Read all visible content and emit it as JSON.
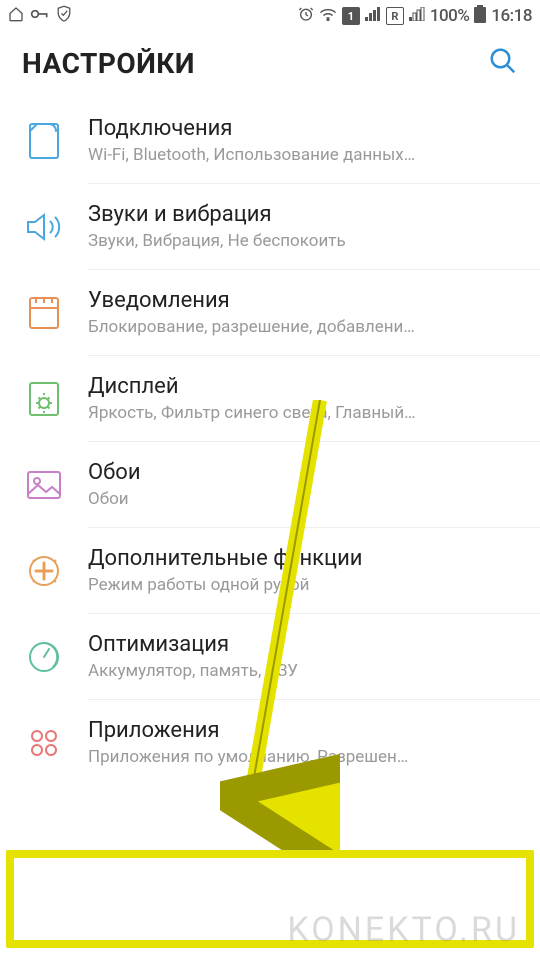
{
  "status": {
    "battery_pct": "100%",
    "time": "16:18",
    "sim1": "1",
    "sim_r": "R"
  },
  "header": {
    "title": "НАСТРОЙКИ"
  },
  "items": [
    {
      "title": "Подключения",
      "sub": "Wi-Fi, Bluetooth, Использование данных…"
    },
    {
      "title": "Звуки и вибрация",
      "sub": "Звуки, Вибрация, Не беспокоить"
    },
    {
      "title": "Уведомления",
      "sub": "Блокирование, разрешение, добавлени…"
    },
    {
      "title": "Дисплей",
      "sub": "Яркость, Фильтр синего света, Главный…"
    },
    {
      "title": "Обои",
      "sub": "Обои"
    },
    {
      "title": "Дополнительные функции",
      "sub": "Режим работы одной рукой"
    },
    {
      "title": "Оптимизация",
      "sub": "Аккумулятор, память, ОЗУ"
    },
    {
      "title": "Приложения",
      "sub": "Приложения по умолчанию, Разрешен…"
    }
  ],
  "watermark": "KONEKTO.RU"
}
